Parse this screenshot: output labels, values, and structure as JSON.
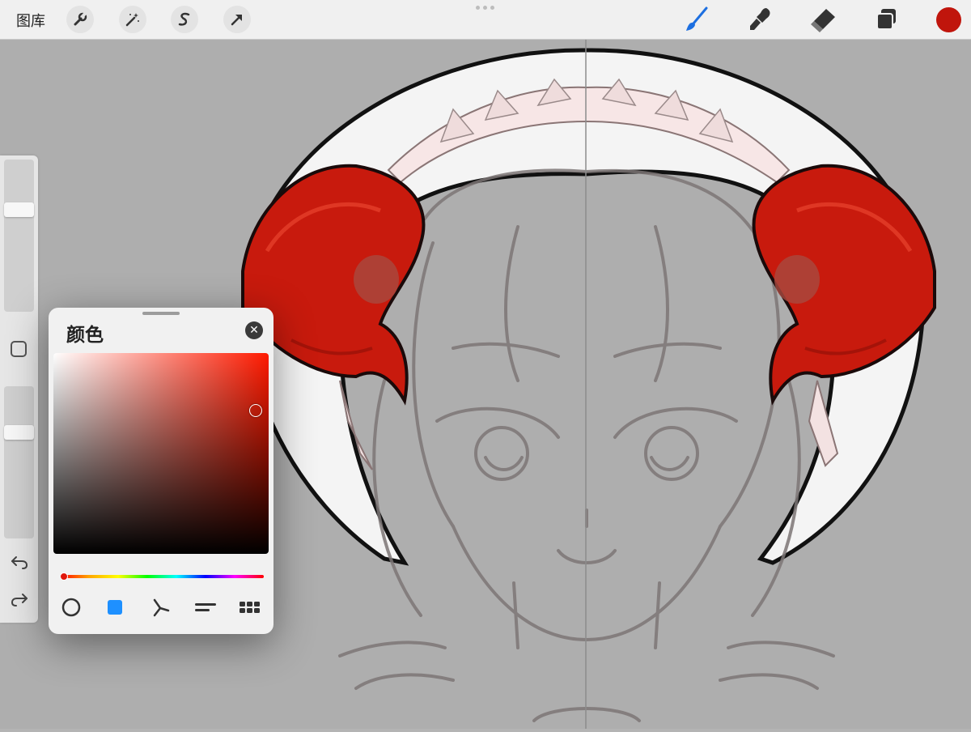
{
  "topbar": {
    "gallery_label": "图库",
    "tools": [
      {
        "name": "actions",
        "icon": "wrench-icon"
      },
      {
        "name": "adjustments",
        "icon": "magic-wand-icon"
      },
      {
        "name": "selection",
        "icon": "selection-s-icon"
      },
      {
        "name": "transform",
        "icon": "arrow-cursor-icon"
      }
    ],
    "right_tools": [
      {
        "name": "brush",
        "icon": "brush-icon",
        "color": "#1d6fe0"
      },
      {
        "name": "smudge",
        "icon": "smudge-icon"
      },
      {
        "name": "eraser",
        "icon": "eraser-icon"
      },
      {
        "name": "layers",
        "icon": "layers-icon"
      }
    ],
    "current_color": "#c0150c"
  },
  "sidebar": {
    "size_slider_level": 0.69,
    "opacity_slider_level": 0.72,
    "undo_icon": "undo-icon",
    "redo_icon": "redo-icon",
    "modify_icon": "square-icon"
  },
  "color_panel": {
    "title": "颜色",
    "close_icon": "close-icon",
    "hue_color": "#ff1a00",
    "selected_color": "#c0150c",
    "modes": [
      {
        "name": "disc",
        "icon": "circle-outline-icon"
      },
      {
        "name": "classic",
        "icon": "filled-square-icon",
        "active": true,
        "color": "#1e90ff"
      },
      {
        "name": "harmony",
        "icon": "harmony-icon"
      },
      {
        "name": "value",
        "icon": "sliders-icon"
      },
      {
        "name": "palettes",
        "icon": "grid-icon"
      }
    ]
  },
  "canvas": {
    "horn_color": "#c81a0d",
    "sketch_color": "#7d7676"
  }
}
